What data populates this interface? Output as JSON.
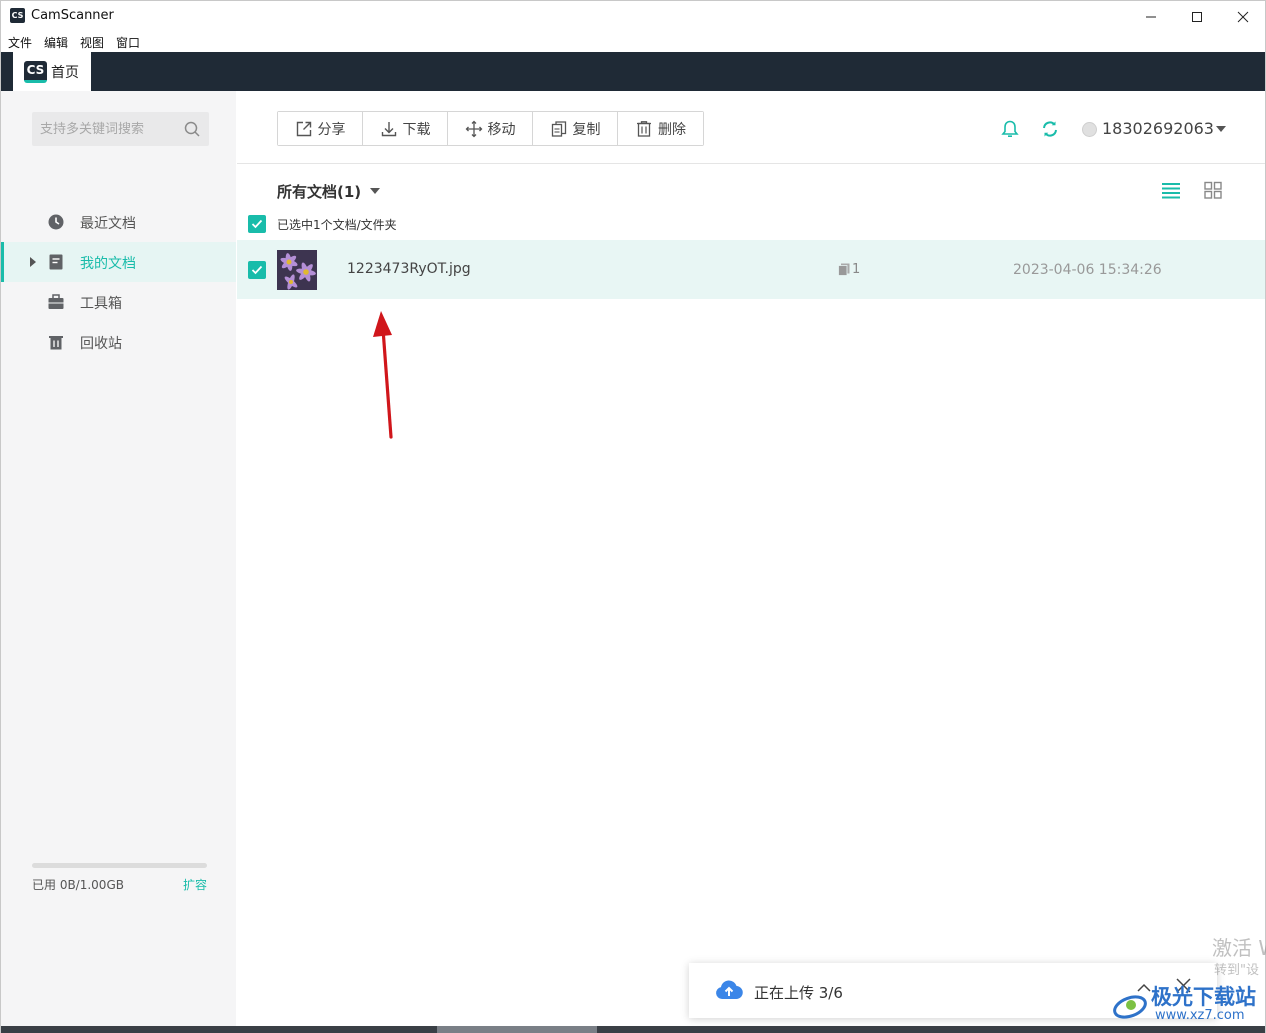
{
  "window": {
    "title": "CamScanner",
    "logo_text": "CS"
  },
  "menubar": {
    "items": [
      "文件",
      "编辑",
      "视图",
      "窗口"
    ]
  },
  "tabs": [
    {
      "label": "首页",
      "logo_text": "CS"
    }
  ],
  "sidebar": {
    "search_placeholder": "支持多关键词搜索",
    "items": [
      {
        "label": "最近文档",
        "icon": "clock-icon"
      },
      {
        "label": "我的文档",
        "icon": "document-icon",
        "active": true
      },
      {
        "label": "工具箱",
        "icon": "toolbox-icon"
      },
      {
        "label": "回收站",
        "icon": "trash-icon"
      }
    ],
    "storage": {
      "used_text": "已用 0B/1.00GB",
      "expand_label": "扩容",
      "used_fraction": 0
    }
  },
  "toolbar": {
    "buttons": [
      {
        "label": "分享",
        "icon": "share-icon"
      },
      {
        "label": "下载",
        "icon": "download-icon"
      },
      {
        "label": "移动",
        "icon": "move-icon"
      },
      {
        "label": "复制",
        "icon": "copy-icon"
      },
      {
        "label": "删除",
        "icon": "delete-icon"
      }
    ]
  },
  "header": {
    "account_id": "18302692063"
  },
  "main": {
    "folder_title": "所有文档(1)",
    "selection_text": "已选中1个文档/文件夹",
    "files": [
      {
        "name": "1223473RyOT.jpg",
        "pages": "1",
        "date": "2023-04-06 15:34:26",
        "selected": true
      }
    ]
  },
  "upload": {
    "status_text": "正在上传 3/6"
  },
  "watermarks": {
    "activate_line1": "激活 W",
    "activate_line2": "转到\"设",
    "site_name": "极光下载站",
    "site_url": "www.xz7.com"
  },
  "colors": {
    "accent": "#19bcaa",
    "dark_header": "#1f2a36",
    "arrow": "#d0161b"
  }
}
